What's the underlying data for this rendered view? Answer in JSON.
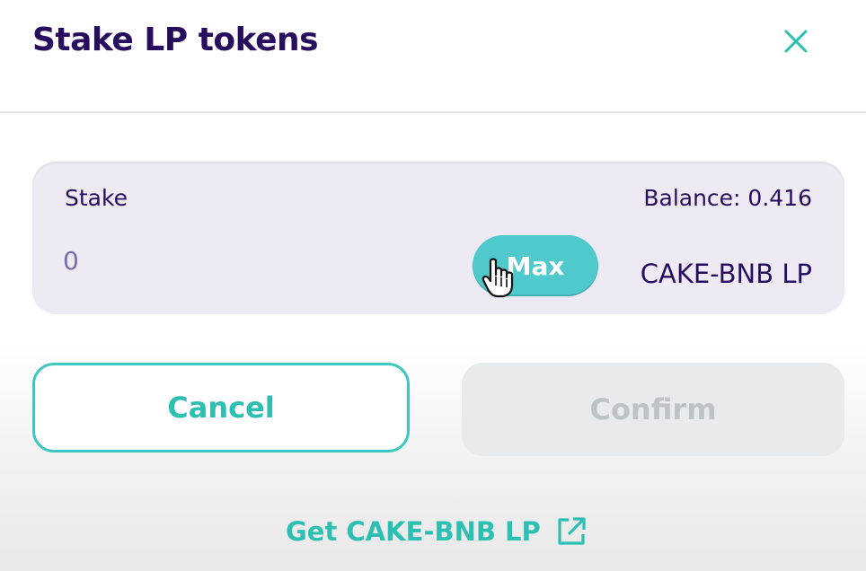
{
  "modal": {
    "title": "Stake LP tokens",
    "close_icon": "close-icon"
  },
  "stake_panel": {
    "label": "Stake",
    "balance_text": "Balance: 0.416",
    "input_value": "",
    "input_placeholder": "0",
    "max_label": "Max",
    "token_label": "CAKE-BNB LP",
    "cursor_icon": "hand-pointer-icon"
  },
  "actions": {
    "cancel_label": "Cancel",
    "confirm_label": "Confirm"
  },
  "footer": {
    "get_lp_label": "Get CAKE-BNB LP",
    "external_icon": "external-link-icon"
  },
  "colors": {
    "title": "#280d5f",
    "accent": "#2ebfb3",
    "max_button": "#4fc9cc",
    "panel_bg": "#eeeaf4",
    "disabled_bg": "#e9eaeb",
    "disabled_text": "#bdc2c4"
  }
}
